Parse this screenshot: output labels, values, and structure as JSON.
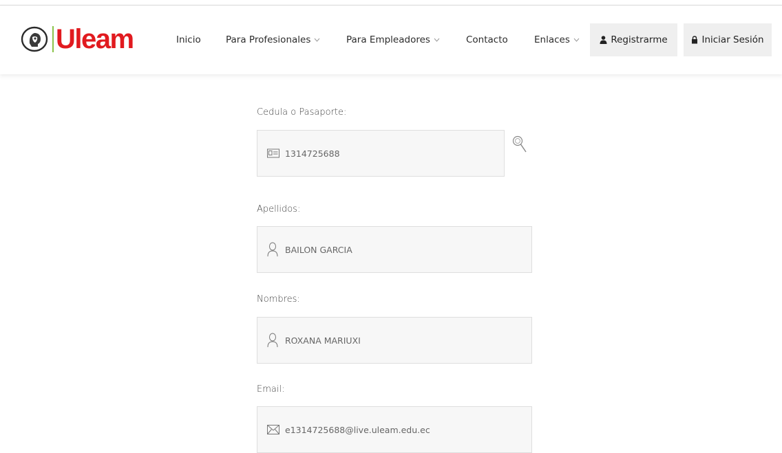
{
  "brand": {
    "name": "Uleam",
    "color": "#e11a1f",
    "accent": "#8bc34a"
  },
  "nav": {
    "inicio": "Inicio",
    "profesionales": "Para Profesionales",
    "empleadores": "Para Empleadores",
    "contacto": "Contacto",
    "enlaces": "Enlaces"
  },
  "actions": {
    "register": "Registrarme",
    "login": "Iniciar Sesión"
  },
  "form": {
    "cedula": {
      "label": "Cedula o Pasaporte:",
      "value": "1314725688",
      "icon": "id-card-icon"
    },
    "apellidos": {
      "label": "Apellidos:",
      "value": "BAILON GARCIA",
      "icon": "user-icon"
    },
    "nombres": {
      "label": "Nombres:",
      "value": "ROXANA MARIUXI",
      "icon": "user-icon"
    },
    "email": {
      "label": "Email:",
      "value": "e1314725688@live.uleam.edu.ec",
      "icon": "envelope-icon"
    },
    "search_icon": "search-icon"
  }
}
